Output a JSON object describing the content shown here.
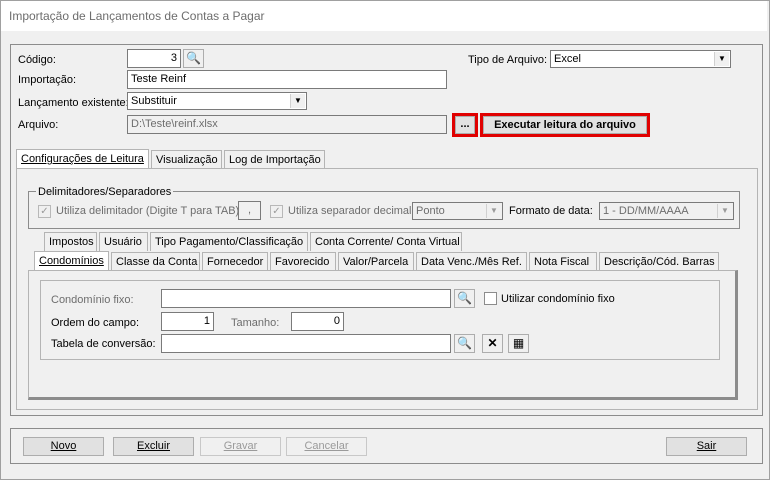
{
  "window": {
    "title": "Importação de Lançamentos de Contas a Pagar"
  },
  "form": {
    "codigo_label": "Código:",
    "codigo_value": "3",
    "tipo_arquivo_label": "Tipo de Arquivo:",
    "tipo_arquivo_value": "Excel",
    "importacao_label": "Importação:",
    "importacao_value": "Teste Reinf",
    "lancamento_label": "Lançamento existente:",
    "lancamento_value": "Substituir",
    "arquivo_label": "Arquivo:",
    "arquivo_value": "D:\\Teste\\reinf.xlsx",
    "browse_label": "...",
    "executar_label": "Executar leitura do arquivo"
  },
  "main_tabs": [
    "Configurações de Leitura",
    "Visualização",
    "Log de Importação"
  ],
  "delimitadores": {
    "group_label": "Delimitadores/Separadores",
    "utiliza_delim_label": "Utiliza delimitador (Digite T para TAB)",
    "delim_value": ",",
    "utiliza_sep_label": "Utiliza separador decimal",
    "sep_value": "Ponto",
    "formato_label": "Formato de data:",
    "formato_value": "1 - DD/MM/AAAA"
  },
  "sub_tabs_row1": [
    "Impostos",
    "Usuário",
    "Tipo Pagamento/Classificação",
    "Conta Corrente/ Conta Virtual"
  ],
  "sub_tabs_row2": [
    "Condomínios",
    "Classe da Conta",
    "Fornecedor",
    "Favorecido",
    "Valor/Parcela",
    "Data Venc./Mês Ref.",
    "Nota Fiscal",
    "Descrição/Cód. Barras"
  ],
  "condominio": {
    "fixo_label": "Condomínio fixo:",
    "fixo_value": "",
    "utilizar_label": "Utilizar condomínio fixo",
    "ordem_label": "Ordem do campo:",
    "ordem_value": "1",
    "tamanho_label": "Tamanho:",
    "tamanho_value": "0",
    "tabela_label": "Tabela de conversão:",
    "tabela_value": ""
  },
  "footer": {
    "novo": "Novo",
    "excluir": "Excluir",
    "gravar": "Gravar",
    "cancelar": "Cancelar",
    "sair": "Sair"
  }
}
